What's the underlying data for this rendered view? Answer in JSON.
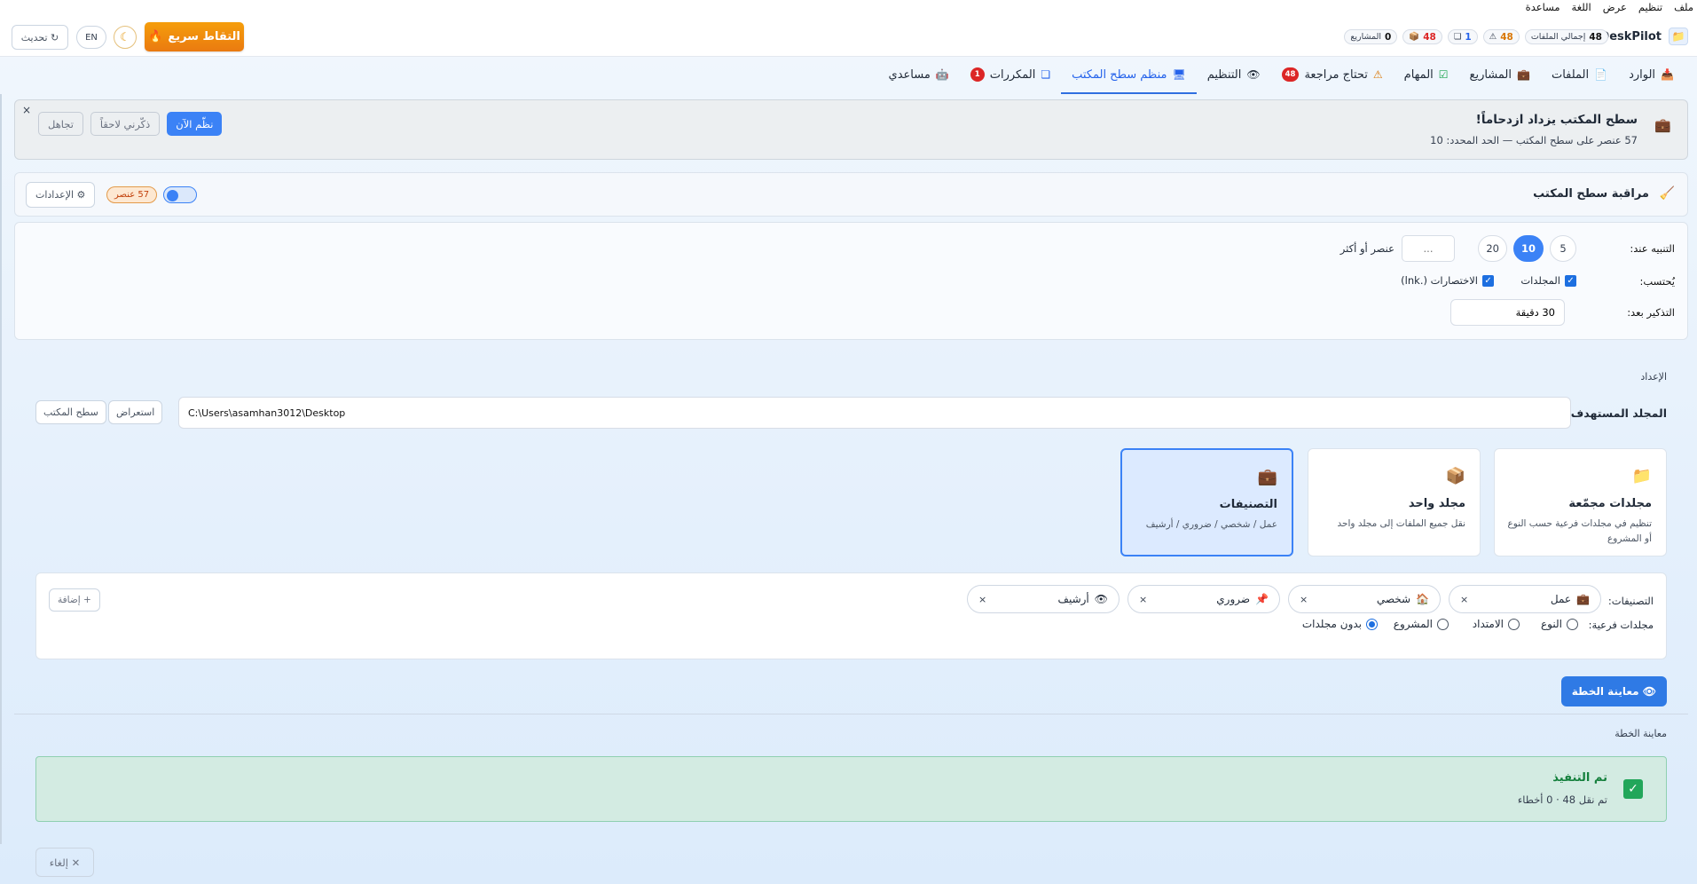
{
  "menu": [
    "ملف",
    "تنظيم",
    "عرض",
    "اللغة",
    "مساعدة"
  ],
  "brand": {
    "name": "DeskPilot",
    "icon": "folder-icon"
  },
  "stats": [
    {
      "value": "48",
      "label": "إجمالي الملفات",
      "icon": ""
    },
    {
      "value": "48",
      "label": "",
      "icon": "warning-icon"
    },
    {
      "value": "1",
      "label": "",
      "icon": "copy-icon"
    },
    {
      "value": "48",
      "label": "",
      "icon": "box-icon"
    },
    {
      "value": "0",
      "label": "المشاريع",
      "icon": ""
    }
  ],
  "header": {
    "quick_capture": "التقاط سريع",
    "lang": "EN",
    "refresh": "↻ تحديث"
  },
  "tabs": [
    {
      "label": "الوارد",
      "icon": "inbox-icon",
      "badge": ""
    },
    {
      "label": "الملفات",
      "icon": "file-icon",
      "badge": ""
    },
    {
      "label": "المشاريع",
      "icon": "briefcase-icon",
      "badge": ""
    },
    {
      "label": "المهام",
      "icon": "check-icon",
      "badge": ""
    },
    {
      "label": "تحتاج مراجعة",
      "icon": "warning-icon",
      "badge": "48"
    },
    {
      "label": "التنظيم",
      "icon": "eye-icon",
      "badge": ""
    },
    {
      "label": "منظم سطح المكتب",
      "icon": "desktop-icon",
      "badge": ""
    },
    {
      "label": "المكررات",
      "icon": "copy-icon",
      "badge": "1"
    },
    {
      "label": "مساعدي",
      "icon": "robot-icon",
      "badge": ""
    }
  ],
  "alert": {
    "title": "سطح المكتب يزداد ازدحاماً!",
    "subtitle": "57 عنصر على سطح المكتب — الحد المحدد: 10",
    "organize_now": "نظّم الآن",
    "remind_later": "ذكّرني لاحقاً",
    "ignore": "تجاهل",
    "close": "×"
  },
  "monitor": {
    "title": "مراقبة سطح المكتب",
    "count": "57 عنصر",
    "settings": "⚙ الإعدادات",
    "enabled": true
  },
  "threshold": {
    "label": "التنبيه عند:",
    "options": [
      "5",
      "10",
      "20"
    ],
    "selected": "10",
    "custom_placeholder": "...",
    "suffix": "عنصر أو أكثر",
    "count_label": "يُحتسب:",
    "count_folders": "المجلدات",
    "count_shortcuts": "الاختصارات (.lnk)",
    "remind_label": "التذكير بعد:",
    "remind_value": "30 دقيقة"
  },
  "setup": {
    "title": "الإعداد",
    "folder_label": "المجلد المستهدف:",
    "path": "C:\\Users\\asamhan3012\\Desktop",
    "browse": "استعراض",
    "desktop": "سطح المكتب"
  },
  "modes": [
    {
      "title": "مجلدات مجمّعة",
      "desc": "تنظيم في مجلدات فرعية حسب النوع أو المشروع",
      "icon": "folder-icon",
      "active": false
    },
    {
      "title": "مجلد واحد",
      "desc": "نقل جميع الملفات إلى مجلد واحد",
      "icon": "box-icon",
      "active": false
    },
    {
      "title": "التصنيفات",
      "desc": "عمل / شخصي / ضروري / أرشيف",
      "icon": "briefcase-icon",
      "active": true
    }
  ],
  "categories": {
    "label": "التصنيفات:",
    "items": [
      {
        "name": "عمل",
        "icon": "briefcase-icon"
      },
      {
        "name": "شخصي",
        "icon": "home-icon"
      },
      {
        "name": "ضروري",
        "icon": "pin-icon"
      },
      {
        "name": "أرشيف",
        "icon": "archive-icon"
      }
    ],
    "add": "+ إضافة",
    "sub_label": "مجلدات فرعية:",
    "sub_options": [
      "النوع",
      "الامتداد",
      "المشروع",
      "بدون مجلدات"
    ],
    "sub_selected": "بدون مجلدات"
  },
  "preview": {
    "button": "معاينة الخطة",
    "section_title": "معاينة الخطة"
  },
  "done": {
    "title": "تم التنفيذ",
    "subtitle": "تم نقل 48 · 0 أخطاء"
  },
  "cancel": "إلغاء",
  "colors": {
    "accent": "#3b82f6",
    "warning": "#ea7a10",
    "success": "#22a65a",
    "danger": "#dc2626"
  }
}
